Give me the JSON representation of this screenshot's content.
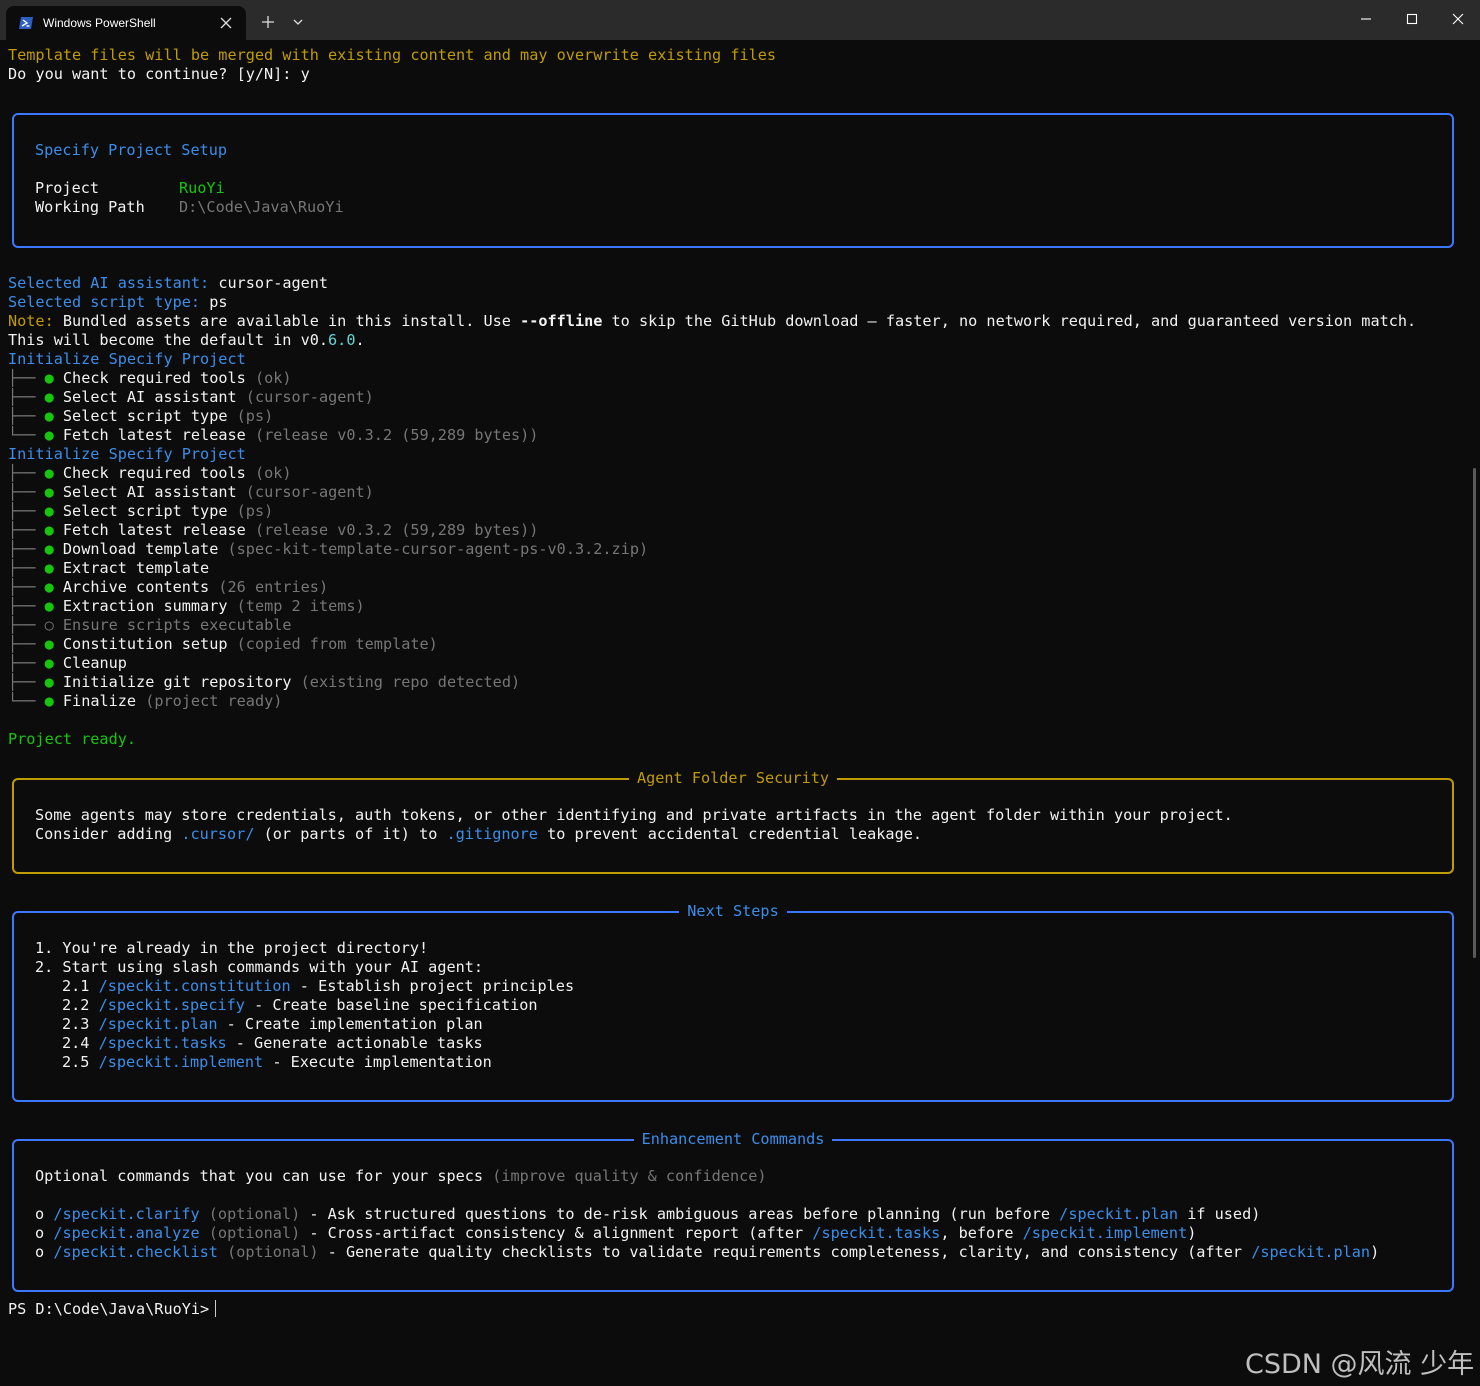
{
  "window": {
    "tab_title": "Windows PowerShell",
    "icons": {
      "tab": "powershell-icon",
      "close": "close-icon",
      "new_tab": "plus-icon",
      "dropdown": "chevron-down-icon",
      "minimize": "minimize-icon",
      "maximize": "maximize-icon",
      "window_close": "close-icon"
    }
  },
  "colors": {
    "accent_blue": "#3b8eea",
    "panel_blue": "#3b78ff",
    "warning_yellow": "#c19c00",
    "success_green": "#16c60c",
    "muted_gray": "#767676",
    "background": "#0c0c0c"
  },
  "prompt_top": {
    "warning": "Template files will be merged with existing content and may overwrite existing files",
    "question": "Do you want to continue? [y/N]: y"
  },
  "setup_panel": {
    "title": "Specify Project Setup",
    "project_label": "Project",
    "project_value": "RuoYi",
    "path_label": "Working Path",
    "path_value": "D:\\Code\\Java\\RuoYi"
  },
  "selection": {
    "ai_label": "Selected AI assistant:",
    "ai_value": "cursor-agent",
    "script_label": "Selected script type:",
    "script_value": "ps",
    "note_label": "Note:",
    "note_pre": "Bundled assets are available in this install. Use",
    "note_flag": "--offline",
    "note_post": "to skip the GitHub download — faster, no network required, and guaranteed version match.",
    "note2_pre": "This will become the default in v0.",
    "note2_num": "6.0",
    "note2_post": "."
  },
  "tree1": {
    "header": "Initialize Specify Project",
    "items": [
      {
        "branch": "├──",
        "dot": "●",
        "label": "Check required tools",
        "detail": "(ok)"
      },
      {
        "branch": "├──",
        "dot": "●",
        "label": "Select AI assistant",
        "detail": "(cursor-agent)"
      },
      {
        "branch": "├──",
        "dot": "●",
        "label": "Select script type",
        "detail": "(ps)"
      },
      {
        "branch": "└──",
        "dot": "●",
        "label": "Fetch latest release",
        "detail": "(release v0.3.2 (59,289 bytes))"
      }
    ]
  },
  "tree2": {
    "header": "Initialize Specify Project",
    "items": [
      {
        "branch": "├──",
        "dot": "●",
        "label": "Check required tools",
        "detail": "(ok)"
      },
      {
        "branch": "├──",
        "dot": "●",
        "label": "Select AI assistant",
        "detail": "(cursor-agent)"
      },
      {
        "branch": "├──",
        "dot": "●",
        "label": "Select script type",
        "detail": "(ps)"
      },
      {
        "branch": "├──",
        "dot": "●",
        "label": "Fetch latest release",
        "detail": "(release v0.3.2 (59,289 bytes))"
      },
      {
        "branch": "├──",
        "dot": "●",
        "label": "Download template",
        "detail": "(spec-kit-template-cursor-agent-ps-v0.3.2.zip)"
      },
      {
        "branch": "├──",
        "dot": "●",
        "label": "Extract template",
        "detail": ""
      },
      {
        "branch": "├──",
        "dot": "●",
        "label": "Archive contents",
        "detail": "(26 entries)"
      },
      {
        "branch": "├──",
        "dot": "●",
        "label": "Extraction summary",
        "detail": "(temp 2 items)"
      },
      {
        "branch": "├──",
        "dot": "○",
        "label": "Ensure scripts executable",
        "detail": "",
        "skipped": true
      },
      {
        "branch": "├──",
        "dot": "●",
        "label": "Constitution setup",
        "detail": "(copied from template)"
      },
      {
        "branch": "├──",
        "dot": "●",
        "label": "Cleanup",
        "detail": ""
      },
      {
        "branch": "├──",
        "dot": "●",
        "label": "Initialize git repository",
        "detail": "(existing repo detected)"
      },
      {
        "branch": "└──",
        "dot": "●",
        "label": "Finalize",
        "detail": "(project ready)"
      }
    ]
  },
  "ready": "Project ready.",
  "security_panel": {
    "title": "Agent Folder Security",
    "line1": "Some agents may store credentials, auth tokens, or other identifying and private artifacts in the agent folder within your project.",
    "line2_pre": "Consider adding",
    "line2_folder": ".cursor/",
    "line2_mid": "(or parts of it) to",
    "line2_file": ".gitignore",
    "line2_post": "to prevent accidental credential leakage."
  },
  "next_steps": {
    "title": "Next Steps",
    "step1": "1. You're already in the project directory!",
    "step2": "2. Start using slash commands with your AI agent:",
    "commands": [
      {
        "num": "2.1",
        "cmd": "/speckit.constitution",
        "desc": "- Establish project principles"
      },
      {
        "num": "2.2",
        "cmd": "/speckit.specify",
        "desc": "- Create baseline specification"
      },
      {
        "num": "2.3",
        "cmd": "/speckit.plan",
        "desc": "- Create implementation plan"
      },
      {
        "num": "2.4",
        "cmd": "/speckit.tasks",
        "desc": "- Generate actionable tasks"
      },
      {
        "num": "2.5",
        "cmd": "/speckit.implement",
        "desc": "- Execute implementation"
      }
    ]
  },
  "enhancement": {
    "title": "Enhancement Commands",
    "intro": "Optional commands that you can use for your specs",
    "intro_detail": "(improve quality & confidence)",
    "bullet": "o",
    "optional": "(optional)",
    "item1": {
      "cmd": "/speckit.clarify",
      "desc": "- Ask structured questions to de-risk ambiguous areas before planning (run before",
      "ref": "/speckit.plan",
      "tail": "if used)"
    },
    "item2": {
      "cmd": "/speckit.analyze",
      "desc": "- Cross-artifact consistency & alignment report (after",
      "ref": "/speckit.tasks",
      "mid": ", before",
      "ref2": "/speckit.implement",
      "tail": ")"
    },
    "item3": {
      "cmd": "/speckit.checklist",
      "desc": "- Generate quality checklists to validate requirements completeness, clarity, and consistency (after",
      "ref": "/speckit.plan",
      "tail": ")"
    }
  },
  "prompt": "PS D:\\Code\\Java\\RuoYi>",
  "watermark": "CSDN @风流 少年"
}
